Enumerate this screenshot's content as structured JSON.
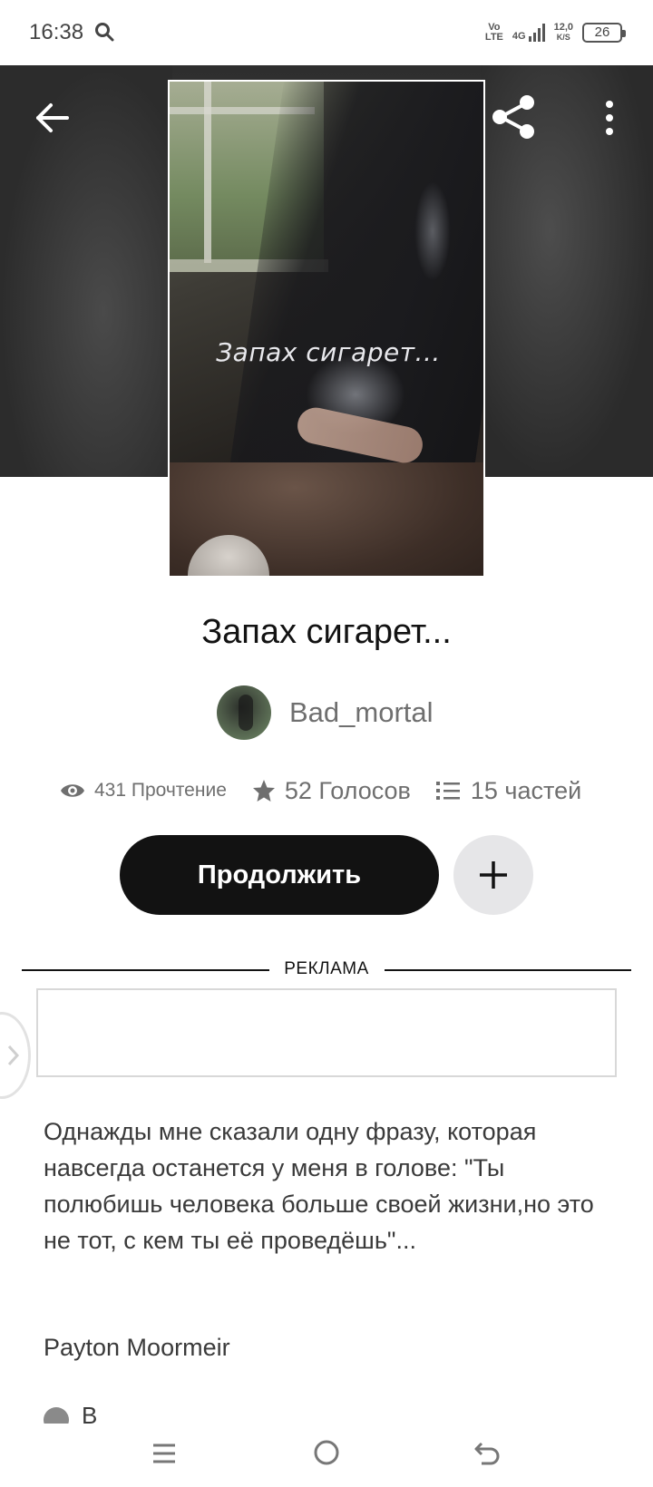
{
  "status_bar": {
    "time": "16:38",
    "volte": "Vo\nLTE",
    "network": "4G",
    "speed": "12,0",
    "speed_unit": "K/S",
    "battery": "26"
  },
  "header": {
    "back_icon": "arrow-left-icon",
    "share_icon": "share-icon",
    "more_icon": "more-vertical-icon"
  },
  "cover": {
    "title": "Запах сигарет..."
  },
  "story": {
    "title": "Запах сигарет...",
    "author": "Bad_mortal",
    "stats": {
      "reads": "431 Прочтение",
      "votes": "52 Голосов",
      "parts": "15 частей"
    },
    "continue_label": "Продолжить",
    "add_icon": "plus-icon",
    "description": "Однажды мне сказали одну фразу, которая навсегда останется у меня в голове: \"Ты полюбишь человека больше своей жизни,но это не тот, с кем ты её проведёшь\"...",
    "description_author": "Payton Moormeir",
    "cut_text": "В"
  },
  "ad": {
    "label": "РЕКЛАМА"
  },
  "nav": {
    "menu_icon": "menu-icon",
    "home_icon": "home-circle-icon",
    "back_icon": "back-icon"
  },
  "colors": {
    "primary": "#121212",
    "muted": "#6f6f6f",
    "hero_bg": "#333333",
    "add_button_bg": "#e6e6e8"
  }
}
